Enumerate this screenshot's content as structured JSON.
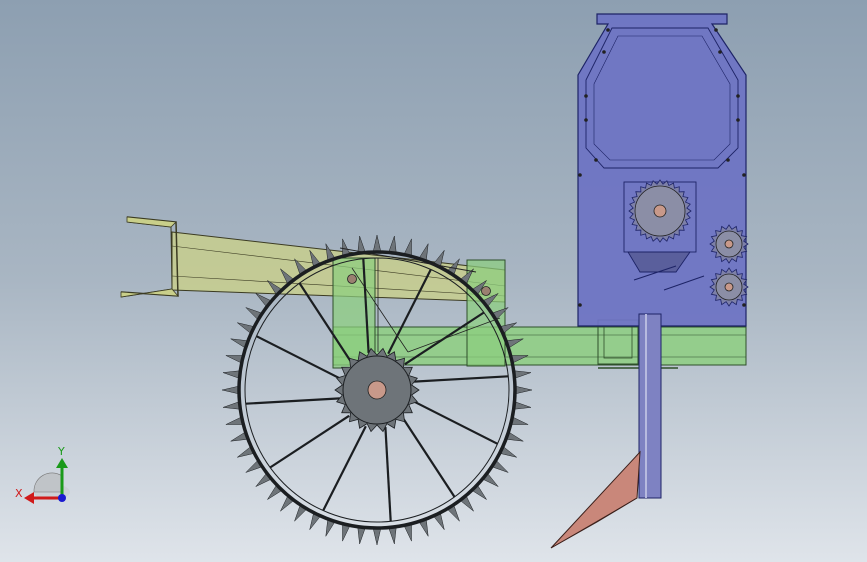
{
  "viewport": {
    "background_top": "#8d9fb1",
    "background_bottom": "#dfe4ea"
  },
  "triad": {
    "x_label": "X",
    "y_label": "Y",
    "x_color": "#d01a1a",
    "y_color": "#1a9a1a",
    "z_color": "#1a1ad0"
  },
  "colors": {
    "frame_green": "#8ccf7e",
    "frame_edge": "#2e4f2a",
    "arm_yellow": "#c9cf8a",
    "hopper_blue": "#6d74c4",
    "hopper_edge": "#1d2366",
    "wheel_grey": "#6e7479",
    "wheel_edge": "#1b1e21",
    "shank_blue": "#7e82c2",
    "blade_pink": "#c9877a"
  },
  "wheel": {
    "spikes": 56,
    "spokes": 12
  }
}
